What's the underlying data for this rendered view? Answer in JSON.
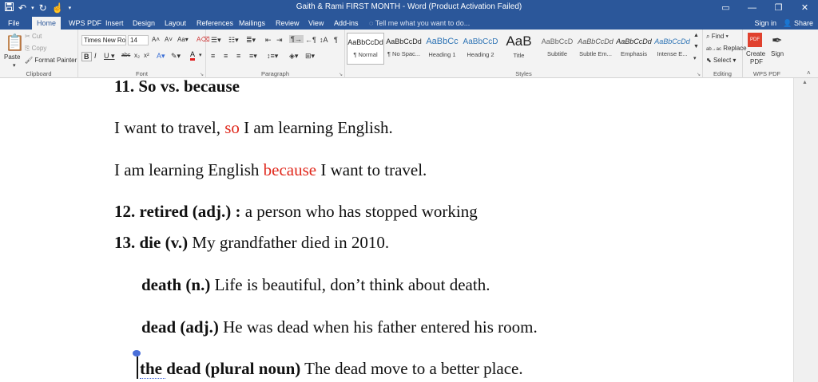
{
  "titlebar": {
    "doc_title": "Gaith & Rami FIRST MONTH - Word (Product Activation Failed)",
    "qat_icons": [
      "save-icon",
      "undo-icon",
      "redo-icon",
      "touch-mode-icon"
    ]
  },
  "tabs": [
    {
      "label": "File"
    },
    {
      "label": "Home"
    },
    {
      "label": "WPS PDF"
    },
    {
      "label": "Insert"
    },
    {
      "label": "Design"
    },
    {
      "label": "Layout"
    },
    {
      "label": "References"
    },
    {
      "label": "Mailings"
    },
    {
      "label": "Review"
    },
    {
      "label": "View"
    },
    {
      "label": "Add-ins"
    }
  ],
  "tellme": "Tell me what you want to do...",
  "signin": "Sign in",
  "share": "Share",
  "ribbon": {
    "clipboard": {
      "paste": "Paste",
      "cut": "Cut",
      "copy": "Copy",
      "format_painter": "Format Painter",
      "label": "Clipboard"
    },
    "font": {
      "name": "Times New Ro",
      "size": "14",
      "label": "Font"
    },
    "paragraph": {
      "label": "Paragraph"
    },
    "styles": {
      "label": "Styles",
      "items": [
        {
          "sample": "AaBbCcDd",
          "name": "¶ Normal"
        },
        {
          "sample": "AaBbCcDd",
          "name": "¶ No Spac..."
        },
        {
          "sample": "AaBbCc",
          "name": "Heading 1"
        },
        {
          "sample": "AaBbCcD",
          "name": "Heading 2"
        },
        {
          "sample": "AaB",
          "name": "Title"
        },
        {
          "sample": "AaBbCcD",
          "name": "Subtitle"
        },
        {
          "sample": "AaBbCcDd",
          "name": "Subtle Em..."
        },
        {
          "sample": "AaBbCcDd",
          "name": "Emphasis"
        },
        {
          "sample": "AaBbCcDd",
          "name": "Intense E..."
        }
      ]
    },
    "editing": {
      "find": "Find",
      "replace": "Replace",
      "select": "Select",
      "label": "Editing"
    },
    "wpspdf": {
      "create": "Create",
      "pdf": "PDF",
      "sign": "Sign",
      "label": "WPS PDF"
    }
  },
  "document": {
    "h11": "11. So vs. because",
    "s1_a": "I want to travel, ",
    "s1_b": "so",
    "s1_c": " I am learning English.",
    "s2_a": "I am learning English ",
    "s2_b": "because",
    "s2_c": " I want to travel.",
    "h12_b": "12. retired (adj.) :",
    "h12_t": " a person who has stopped working",
    "h13_b": "13. die (v.)",
    "h13_t": " My grandfather died in 2010.",
    "d1_b": "death (n.)",
    "d1_t": " Life is beautiful, don’t think about death.",
    "d2_b": "dead (adj.)",
    "d2_t": " He was dead when his father entered his room.",
    "d3_b": "the dead (plural noun)",
    "d3_t": "  The dead move to a better place."
  }
}
